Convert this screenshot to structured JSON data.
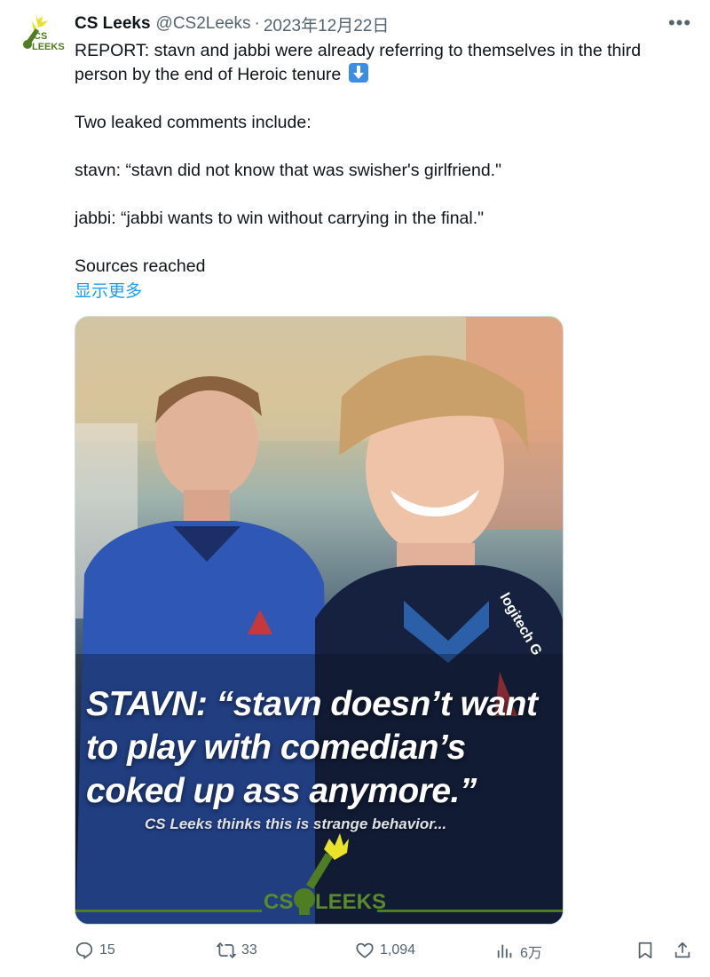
{
  "account": {
    "name": "CS Leeks",
    "handle": "@CS2Leeks",
    "separator": "·",
    "date": "2023年12月22日",
    "avatar_text_top": "CS",
    "avatar_text_bottom": "LEEKS"
  },
  "tweet": {
    "line1": "REPORT: stavn and jabbi were already referring to themselves in the third",
    "line2": "person by the end of Heroic tenure",
    "line2_emoji": "down-arrow-emoji",
    "para2": "Two leaked comments include:",
    "para3": "stavn: “stavn did not know that was swisher's girlfriend.\"",
    "para4": "jabbi: “jabbi wants to win without carrying in the final.\"",
    "para5": "Sources reached",
    "show_more": "显示更多"
  },
  "media": {
    "headline_line1": "STAVN: “stavn doesn’t want",
    "headline_line2": "to play with comedian’s",
    "headline_line3": "coked up ass anymore.”",
    "subline": "CS Leeks thinks this is strange behavior...",
    "logo_left": "CS",
    "logo_right": "LEEKS",
    "brand_accent": "#5b8a2a"
  },
  "actions": {
    "replies": "15",
    "retweets": "33",
    "likes": "1,094",
    "views": "6万",
    "icons": [
      "reply-icon",
      "retweet-icon",
      "like-icon",
      "views-icon",
      "bookmark-icon",
      "share-icon"
    ]
  },
  "colors": {
    "link": "#1d9bf0",
    "secondary_text": "#536471",
    "primary_text": "#0f1419"
  }
}
